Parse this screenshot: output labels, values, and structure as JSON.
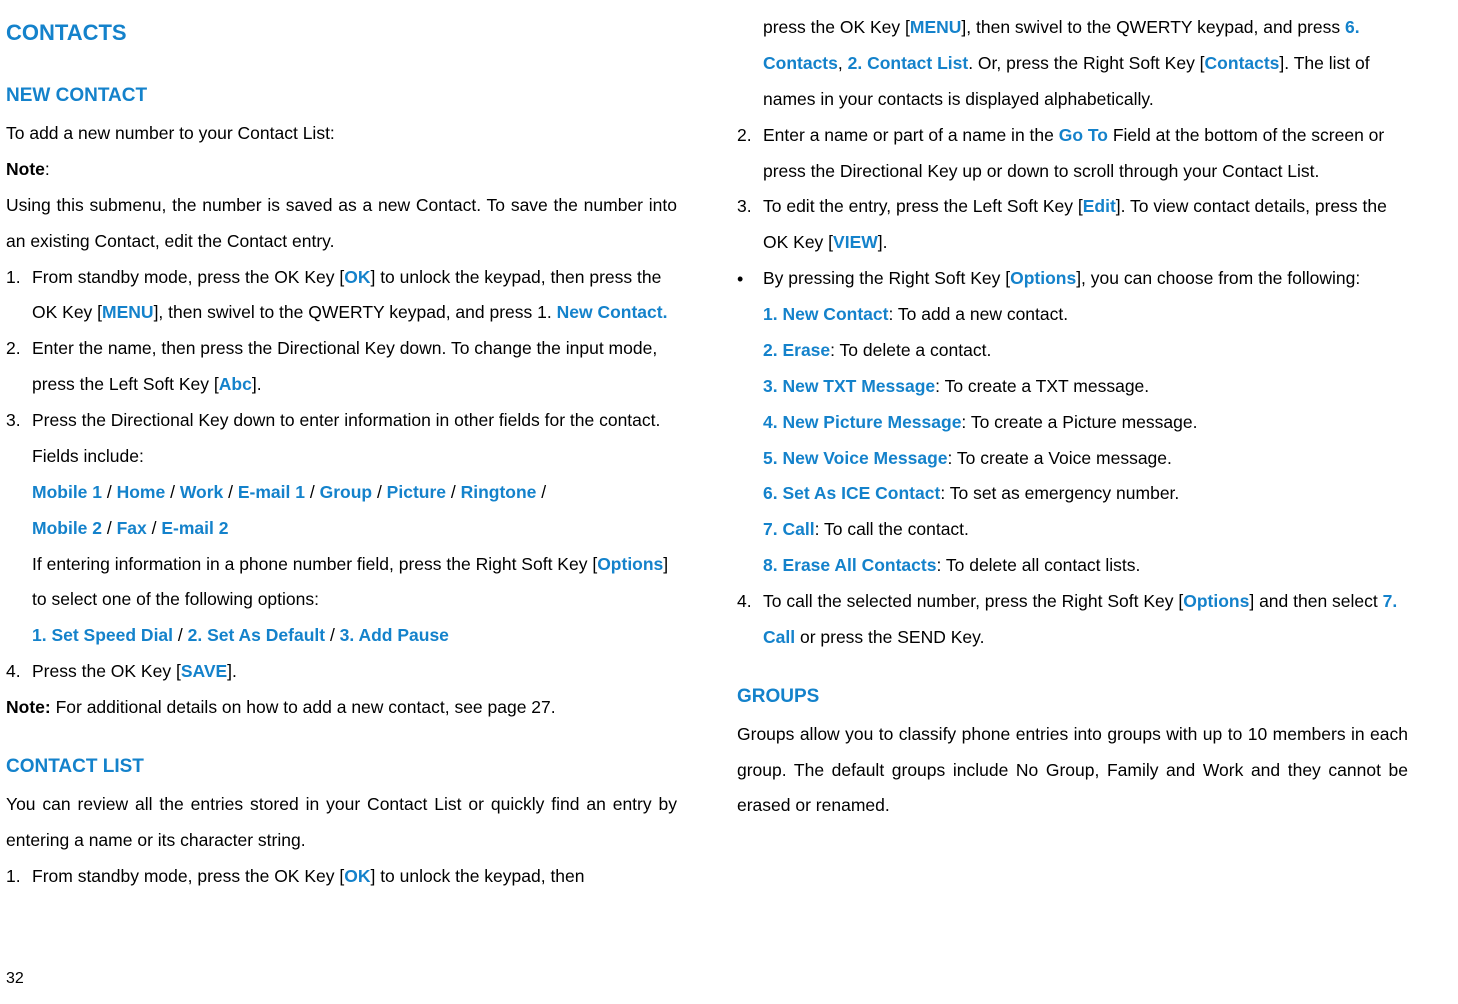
{
  "left": {
    "title": "CONTACTS",
    "newContact": {
      "heading": "NEW CONTACT",
      "intro": "To add a new number to your Contact List:",
      "noteLabel": "Note",
      "noteColon": ":",
      "noteBody": "Using this submenu, the number is saved as a new Contact. To save the number into an existing Contact, edit the Contact entry.",
      "s1_a": "From standby mode, press the OK Key [",
      "s1_ok": "OK",
      "s1_b": "] to unlock the keypad, then press the OK Key [",
      "s1_menu": "MENU",
      "s1_c": "], then swivel to the QWERTY keypad, and press 1. ",
      "s1_new": "New Contact.",
      "s2_a": "Enter the name, then press the Directional Key down. To change the input mode, press the Left Soft Key [",
      "s2_abc": "Abc",
      "s2_b": "].",
      "s3_a": "Press the Directional Key down to enter information in other fields for the contact. Fields include:",
      "fields_m1": "Mobile 1",
      "sep": " / ",
      "fields_home": "Home",
      "fields_work": "Work",
      "fields_e1": "E-mail 1",
      "fields_group": "Group",
      "fields_pic": "Picture",
      "fields_ring": "Ringtone",
      "fields_m2": "Mobile 2",
      "fields_fax": "Fax",
      "fields_e2": "E-mail 2",
      "s3_b": "If entering information in a phone number field, press the Right Soft Key [",
      "s3_opt": "Options",
      "s3_c": "] to select one of the following options:",
      "opt1": "1. Set Speed Dial",
      "opt2": "2. Set As Default",
      "opt3": "3. Add Pause",
      "s4_a": "Press the OK Key [",
      "s4_save": "SAVE",
      "s4_b": "].",
      "note2Label": "Note:",
      "note2Body": " For additional details on how to add a new contact, see page 27."
    },
    "contactList": {
      "heading": "CONTACT LIST",
      "intro": "You can review all the entries stored in your Contact List or quickly find an entry by entering a name or its character string.",
      "s1_a": "From standby mode, press the OK Key [",
      "s1_ok": "OK",
      "s1_b": "] to unlock the keypad, then"
    }
  },
  "right": {
    "cont": {
      "s1_c": "press the OK Key [",
      "s1_menu": "MENU",
      "s1_d": "], then swivel to the QWERTY keypad, and press ",
      "s1_six": "6. Contacts",
      "s1_comma": ", ",
      "s1_two": "2. Contact List",
      "s1_e": ". Or, press the Right Soft Key [",
      "s1_contacts": "Contacts",
      "s1_f": "]. The list of names in your contacts is displayed alphabetically.",
      "s2_a": "Enter a name or part of a name in the ",
      "s2_goto": "Go To",
      "s2_b": " Field at the bottom of the screen or press the Directional Key up or down to scroll through your Contact List.",
      "s3_a": "To edit the entry, press the Left Soft Key [",
      "s3_edit": "Edit",
      "s3_b": "]. To view contact details, press the OK Key [",
      "s3_view": "VIEW",
      "s3_c": "].",
      "bullet_a": "By pressing the Right Soft Key [",
      "bullet_opt": "Options",
      "bullet_b": "], you can choose from the following:",
      "o1a": "1. New Contact",
      "o1b": ": To add a new contact.",
      "o2a": "2. Erase",
      "o2b": ": To delete a contact.",
      "o3a": "3. New TXT Message",
      "o3b": ": To create a TXT message.",
      "o4a": "4. New Picture Message",
      "o4b": ": To create a Picture message.",
      "o5a": "5. New Voice Message",
      "o5b": ": To create a Voice message.",
      "o6a": "6. Set As ICE Contact",
      "o6b": ": To set as emergency number.",
      "o7a": "7. Call",
      "o7b": ": To call the contact.",
      "o8a": "8. Erase All Contacts",
      "o8b": ": To delete all contact lists.",
      "s4_a": "To call the selected number, press the Right Soft Key [",
      "s4_opt": "Options",
      "s4_b": "] and then select ",
      "s4_call": "7. Call",
      "s4_c": " or press the SEND Key."
    },
    "groups": {
      "heading": "GROUPS",
      "body": "Groups allow you to classify phone entries into groups with up to 10 members in each group. The default groups include No Group, Family and Work and they cannot be erased or renamed."
    }
  },
  "pageNum": "32",
  "nums": {
    "n1": "1.",
    "n2": "2.",
    "n3": "3.",
    "n4": "4.",
    "bullet": "•"
  }
}
